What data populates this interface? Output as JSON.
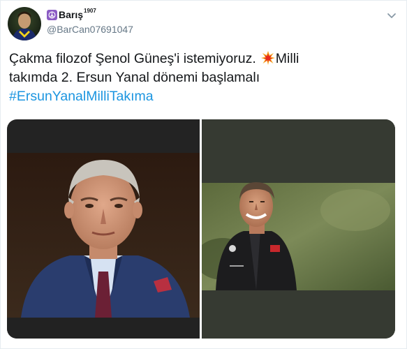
{
  "user": {
    "display_name": "Barış",
    "display_name_sup": "1907",
    "handle": "@BarCan07691047",
    "avatar_icon": "avatar-photo",
    "badge_icon": "peace-sign-icon",
    "badge_color": "#8b5cc4"
  },
  "tweet": {
    "line1_text": "Çakma filozof Şenol Güneş'i istemiyoruz.",
    "emoji_icon": "collision-icon",
    "line1_suffix": "Milli",
    "line2_text": "takımda 2. Ersun Yanal dönemi başlamalı",
    "hashtag": "#ErsunYanalMilliTakıma"
  },
  "media": {
    "photo_left": "portrait-man-suit-photo",
    "photo_right": "man-training-jacket-photo"
  },
  "colors": {
    "text": "#14171a",
    "secondary": "#657786",
    "link": "#1b95e0"
  },
  "menu_icon": "chevron-down-icon"
}
